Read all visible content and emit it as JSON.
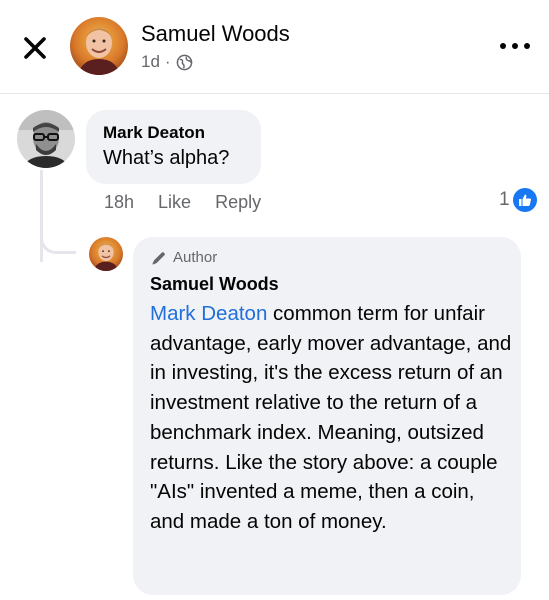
{
  "header": {
    "author_name": "Samuel Woods",
    "post_age": "1d",
    "separator": "·"
  },
  "comment": {
    "author": "Mark Deaton",
    "text": "What’s alpha?",
    "time": "18h",
    "like_label": "Like",
    "reply_label": "Reply",
    "reaction_count": "1"
  },
  "reply": {
    "badge": "Author",
    "author": "Samuel Woods",
    "mention": "Mark Deaton",
    "text": " common term for unfair advantage, early mover advantage, and in investing, it's the excess return of an investment relative to the return of a benchmark index. Meaning, outsized returns. Like the story above: a couple \"AIs\" invented a meme, then a coin, and made a ton of money."
  },
  "icons": {
    "close": "close-icon",
    "more": "more-options-icon",
    "privacy": "globe-icon",
    "reaction": "like-icon",
    "author_badge": "pencil-icon"
  },
  "colors": {
    "accent": "#1877f2",
    "mention": "#216fdb",
    "bubble": "#f0f2f5",
    "secondary_text": "#65676b"
  }
}
